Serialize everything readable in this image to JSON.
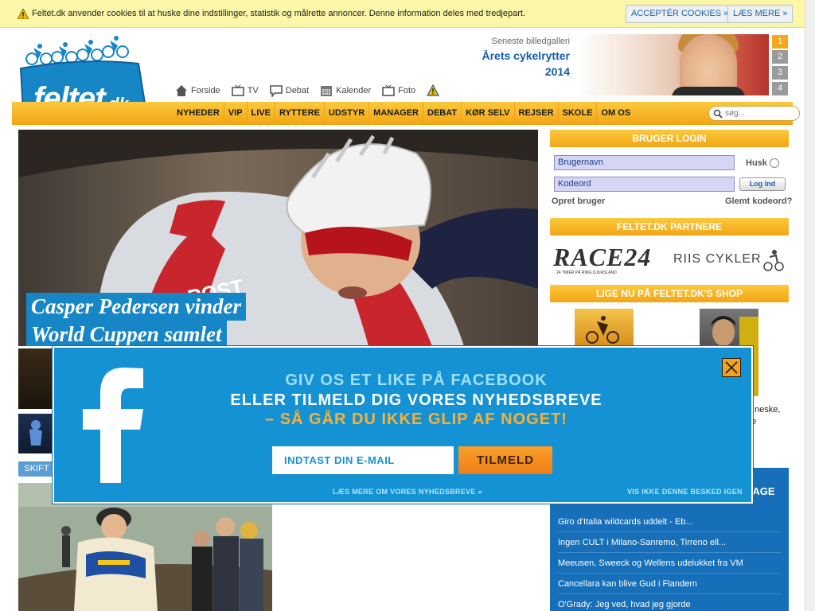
{
  "cookie": {
    "text": "Feltet.dk anvender cookies til at huske dine indstillinger, statistik og målrette annoncer. Denne information deles med tredjepart.",
    "accept_label": "ACCEPTÉR COOKIES »",
    "more_label": "LÆS MERE »"
  },
  "logo": {
    "text": "feltet",
    "suffix": ".dk"
  },
  "topnav": [
    {
      "label": "Forside",
      "icon": "home-icon"
    },
    {
      "label": "TV",
      "icon": "tv-icon"
    },
    {
      "label": "Debat",
      "icon": "chat-icon"
    },
    {
      "label": "Kalender",
      "icon": "calendar-icon"
    },
    {
      "label": "Foto",
      "icon": "camera-icon"
    }
  ],
  "gallery": {
    "label": "Seneste billedgalleri",
    "title": "Årets cykelrytter",
    "year": "2014",
    "pages": [
      "1",
      "2",
      "3",
      "4"
    ]
  },
  "mainnav": [
    "NYHEDER",
    "VIP",
    "LIVE",
    "RYTTERE",
    "UDSTYR",
    "MANAGER",
    "DEBAT",
    "KØR SELV",
    "REJSER",
    "SKOLE",
    "OM OS"
  ],
  "search": {
    "placeholder": "søg..."
  },
  "hero": {
    "line1": "Casper Pedersen vinder",
    "line2": "World Cuppen samlet",
    "jersey_text": "POST"
  },
  "skift_label": "SKIFT",
  "sidebar": {
    "login_title": "BRUGER LOGIN",
    "username_placeholder": "Brugernavn",
    "password_placeholder": "Kodeord",
    "remember_label": "Husk",
    "login_button": "Log Ind",
    "create_user": "Opret bruger",
    "forgot": "Glemt kodeord?",
    "partners_title": "FELTET.DK PARTNERE",
    "partner1": "RACE24",
    "partner1_sub": "24 TIMER PÅ RING DJURSLAND",
    "partner2": "RIIS CYKLER",
    "shop_title": "LIGE NU PÅ FELTET.DK'S SHOP",
    "shop_partial1": "neske,",
    "shop_partial2": "e",
    "news_partial_title": "DAGE",
    "news": [
      "Giro d'Italia wildcards uddelt - Eb...",
      "Ingen CULT i Milano-Sanremo, Tirreno ell...",
      "Meeusen, Sweeck og Wellens udelukket fra VM",
      "Cancellara kan blive Gud i Flandern",
      "O'Grady: Jeg ved, hvad jeg gjorde"
    ]
  },
  "modal": {
    "line1": "GIV OS ET LIKE PÅ FACEBOOK",
    "line2": "ELLER TILMELD DIG VORES NYHEDSBREVE",
    "line3": "– SÅ GÅR DU IKKE GLIP AF NOGET!",
    "email_placeholder": "INDTAST DIN E-MAIL",
    "subscribe_label": "TILMELD",
    "read_more": "LÆS MERE OM VORES NYHEDSBREVE »",
    "hide": "VIS IKKE DENNE BESKED IGEN"
  },
  "colors": {
    "brand_blue": "#1686c7",
    "nav_orange": "#f2a516",
    "modal_blue": "#1592d4"
  }
}
